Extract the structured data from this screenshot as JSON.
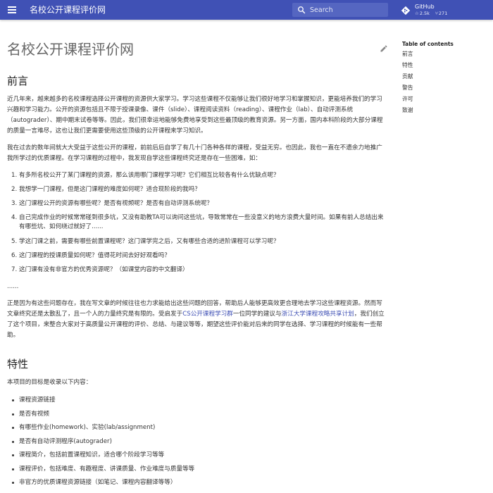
{
  "header": {
    "site_title": "名校公开课程评价网",
    "search_placeholder": "Search",
    "repo": {
      "name": "GitHub",
      "stars": "2.5k",
      "forks": "271"
    }
  },
  "page": {
    "title": "名校公开课程评价网",
    "sections": {
      "intro": {
        "heading": "前言",
        "p1": "近几年来，越来越多的名校课程选择公开课程的资源供大家学习。学习这些课程不仅能够让我们很好地学习和掌握知识，更能培养我们的学习兴趣和学习能力。公开的资源包括且不限于授课录像、课件（slide）、课程阅读资料（reading）、课程作业（lab）、自动评测系统（autograder）、期中期末试卷等等。因此，我们很幸运地能够免费地享受到这些最顶级的教育资源。另一方面，国内本科阶段的大部分课程的质量一言难尽，这也让我们更需要使用这些顶级的公开课程来学习知识。",
        "p2": "我在过去的数年间就大大受益于这些公开的课程，前前后后自学了有几十门各种各样的课程，受益无穷。也因此，我也一直在不遗余力地推广我所学过的优质课程。在学习课程的过程中，我发现自学这些课程终究还是存在一些困难，如：",
        "questions": [
          "有多所名校公开了某门课程的资源，那么该用哪门课程学习呢？它们相互比较各有什么优缺点呢？",
          "我想学一门课程，但是这门课程的难度如何呢？适合现阶段的我吗？",
          "这门课程公开的资源有哪些呢？是否有视频呢？是否有自动评测系统呢？",
          "自己完成作业的时候常常碰到很多坑，又没有助教TA可以询问这些坑，导致常常在一些没意义的地方浪费大量时间。如果有前人总结出来有哪些坑、如何绕过就好了......",
          "学这门课之前，需要有哪些前置课程呢？这门课学完之后，又有哪些合适的进阶课程可以学习呢？",
          "这门课程的授课质量如何呢？值得花时间去好好观看吗？",
          "这门课有没有非官方的优秀资源呢？（如课堂内容的中文翻译）"
        ],
        "ellipsis": "......",
        "p3_before": "正是因为有这些问题存在，我在写文章的时候往往也力求能给出这些问题的回答，帮助后人能够更高效更合理地去学习这些课程资源。然而写文章终究还是太散乱了，且一个人的力量终究是有限的。受启发于",
        "p3_link1": "CS公开课程学习群",
        "p3_middle": "一位同学的建议与",
        "p3_link2": "浙江大学课程攻略共享计划",
        "p3_after": "，我们创立了这个项目，来整合大家对于高质量公开课程的评价、总结、与建议等等，期望这些评价能对后来的同学在选择、学习课程的时候能有一些帮助。"
      },
      "features": {
        "heading": "特性",
        "lead": "本项目的目标是收录以下内容：",
        "items": [
          "课程资源链接",
          "是否有视频",
          "有哪些作业(homework)、实验(lab/assignment)",
          "是否有自动评测程序(autograder)",
          "课程简介，包括前置课程知识，适合哪个阶段学习等等",
          "课程评价，包括难度、有趣程度、讲课质量、作业难度与质量等等",
          "非官方的优质课程资源链接（如笔记、课程内容翻译等等）"
        ]
      }
    }
  },
  "toc": {
    "title": "Table of contents",
    "items": [
      "前言",
      "特性",
      "贡献",
      "警告",
      "许可",
      "致谢"
    ]
  }
}
